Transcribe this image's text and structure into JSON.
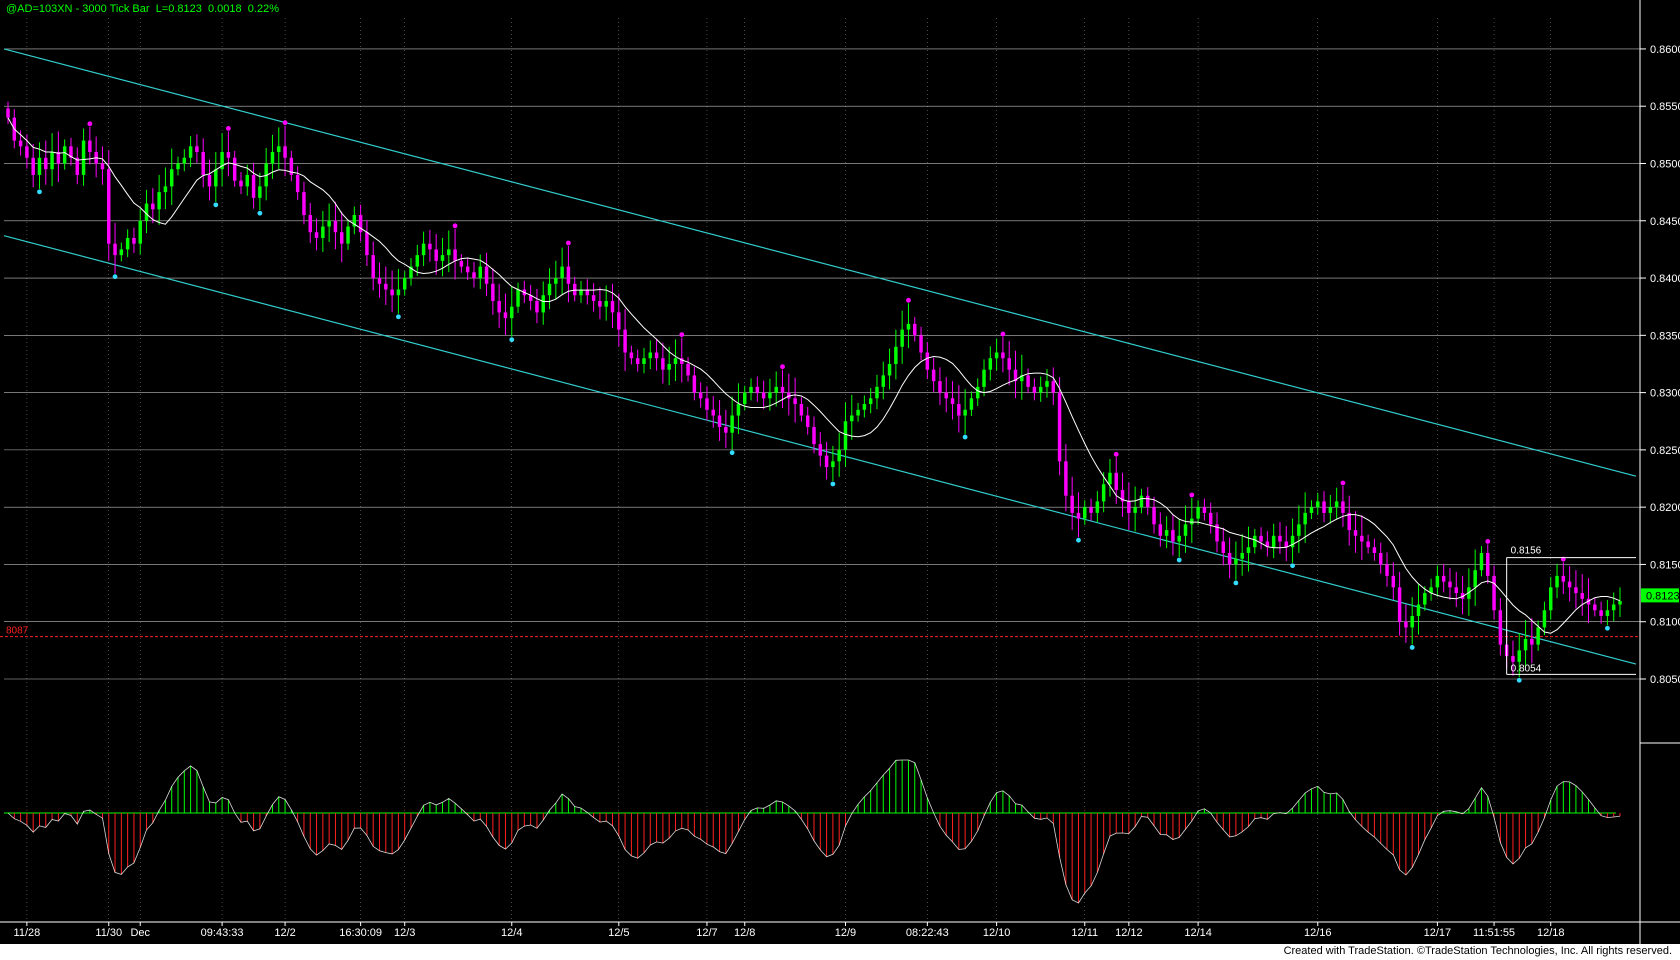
{
  "header": {
    "symbol": "@AD=103XN",
    "separator": " - ",
    "interval": "3000 Tick Bar",
    "last": "L=0.8123",
    "change": "0.0018",
    "pct": "0.22%"
  },
  "footer": {
    "credit": "Created with TradeStation. ©TradeStation Technologies, Inc. All rights reserved."
  },
  "colors": {
    "background": "#000000",
    "up_candle": "#00ff00",
    "down_candle": "#ff00ff",
    "channel": "#33cccc",
    "moving_average": "#ffffff",
    "swing_high_dot": "#ff00ff",
    "swing_low_dot": "#33ddff",
    "osc_positive": "#00ff00",
    "osc_negative": "#ff2020",
    "ref_line": "#ff2020",
    "grid": "#ffffff"
  },
  "chart_data": {
    "type": "line",
    "y_axis": {
      "ticks": [
        0.86,
        0.855,
        0.85,
        0.845,
        0.84,
        0.835,
        0.83,
        0.825,
        0.82,
        0.815,
        0.81,
        0.805
      ],
      "tick_labels": [
        "0.8600",
        "0.8550",
        "0.8500",
        "0.8450",
        "0.8400",
        "0.8350",
        "0.8300",
        "0.8250",
        "0.8200",
        "0.8150",
        "0.8100",
        "0.8050"
      ],
      "range": [
        0.7995,
        0.8627
      ]
    },
    "x_labels": [
      {
        "label": "11/28",
        "bar": 3
      },
      {
        "label": "11/30",
        "bar": 16
      },
      {
        "label": "Dec",
        "bar": 21
      },
      {
        "label": "09:43:33",
        "bar": 34
      },
      {
        "label": "12/2",
        "bar": 44
      },
      {
        "label": "16:30:09",
        "bar": 56
      },
      {
        "label": "12/3",
        "bar": 63
      },
      {
        "label": "12/4",
        "bar": 80
      },
      {
        "label": "12/5",
        "bar": 97
      },
      {
        "label": "12/7",
        "bar": 111
      },
      {
        "label": "12/8",
        "bar": 117
      },
      {
        "label": "12/9",
        "bar": 133
      },
      {
        "label": "08:22:43",
        "bar": 146
      },
      {
        "label": "12/10",
        "bar": 157
      },
      {
        "label": "12/11",
        "bar": 171
      },
      {
        "label": "12/12",
        "bar": 178
      },
      {
        "label": "12/14",
        "bar": 189
      },
      {
        "label": "12/16",
        "bar": 208
      },
      {
        "label": "12/17",
        "bar": 227
      },
      {
        "label": "11:51:55",
        "bar": 236
      },
      {
        "label": "12/18",
        "bar": 245
      }
    ],
    "bar_count": 257,
    "closes": [
      0.854,
      0.852,
      0.8515,
      0.8505,
      0.849,
      0.8505,
      0.8495,
      0.851,
      0.85,
      0.8515,
      0.8505,
      0.849,
      0.852,
      0.851,
      0.85,
      0.8495,
      0.843,
      0.842,
      0.8425,
      0.8435,
      0.843,
      0.845,
      0.8465,
      0.846,
      0.8475,
      0.848,
      0.8495,
      0.85,
      0.8505,
      0.8515,
      0.851,
      0.849,
      0.848,
      0.8495,
      0.851,
      0.8505,
      0.8485,
      0.848,
      0.849,
      0.847,
      0.848,
      0.85,
      0.851,
      0.8515,
      0.8505,
      0.849,
      0.8475,
      0.8455,
      0.844,
      0.8435,
      0.8445,
      0.845,
      0.844,
      0.843,
      0.8445,
      0.8455,
      0.844,
      0.842,
      0.84,
      0.8395,
      0.839,
      0.8385,
      0.839,
      0.84,
      0.841,
      0.842,
      0.843,
      0.8425,
      0.8415,
      0.842,
      0.8425,
      0.8415,
      0.841,
      0.8405,
      0.84,
      0.841,
      0.8395,
      0.838,
      0.837,
      0.8365,
      0.8375,
      0.839,
      0.8385,
      0.838,
      0.837,
      0.8385,
      0.8395,
      0.84,
      0.841,
      0.8395,
      0.8385,
      0.839,
      0.8385,
      0.838,
      0.8375,
      0.838,
      0.837,
      0.8355,
      0.8335,
      0.833,
      0.8325,
      0.833,
      0.8335,
      0.833,
      0.832,
      0.8325,
      0.833,
      0.8325,
      0.8315,
      0.83,
      0.8295,
      0.8285,
      0.828,
      0.827,
      0.8265,
      0.828,
      0.829,
      0.83,
      0.8305,
      0.83,
      0.8295,
      0.83,
      0.8305,
      0.83,
      0.8295,
      0.829,
      0.828,
      0.827,
      0.8255,
      0.8245,
      0.8235,
      0.824,
      0.825,
      0.8275,
      0.828,
      0.8285,
      0.829,
      0.8295,
      0.8305,
      0.8315,
      0.8325,
      0.834,
      0.8355,
      0.836,
      0.835,
      0.8335,
      0.832,
      0.831,
      0.83,
      0.8295,
      0.829,
      0.828,
      0.8285,
      0.8295,
      0.8305,
      0.832,
      0.833,
      0.8335,
      0.833,
      0.832,
      0.831,
      0.8315,
      0.8305,
      0.83,
      0.8305,
      0.831,
      0.83,
      0.824,
      0.821,
      0.8195,
      0.819,
      0.82,
      0.8195,
      0.8205,
      0.822,
      0.823,
      0.8215,
      0.8205,
      0.8195,
      0.82,
      0.821,
      0.82,
      0.8185,
      0.8175,
      0.818,
      0.817,
      0.8175,
      0.8185,
      0.819,
      0.82,
      0.8195,
      0.8185,
      0.817,
      0.816,
      0.815,
      0.8155,
      0.816,
      0.8165,
      0.8175,
      0.817,
      0.8165,
      0.8175,
      0.817,
      0.8165,
      0.8175,
      0.8185,
      0.8195,
      0.82,
      0.8205,
      0.8195,
      0.82,
      0.8205,
      0.8195,
      0.818,
      0.8175,
      0.817,
      0.8165,
      0.816,
      0.815,
      0.814,
      0.813,
      0.81,
      0.8095,
      0.8105,
      0.8115,
      0.8125,
      0.813,
      0.814,
      0.8135,
      0.813,
      0.8125,
      0.812,
      0.813,
      0.8145,
      0.816,
      0.814,
      0.811,
      0.808,
      0.807,
      0.8065,
      0.8075,
      0.8085,
      0.808,
      0.8095,
      0.811,
      0.813,
      0.814,
      0.8135,
      0.813,
      0.8125,
      0.812,
      0.8115,
      0.811,
      0.8105,
      0.811,
      0.8115,
      0.8118,
      0.8123
    ],
    "annotations": {
      "ref_line": {
        "value": 0.8087,
        "label": "8087"
      },
      "last_price": {
        "value": 0.8123,
        "label": "0.8123"
      },
      "range_box": {
        "high": 0.8156,
        "low": 0.8054,
        "high_label": "0.8156",
        "low_label": "0.8054",
        "bar_start": 238,
        "bar_end": 257
      }
    },
    "channel": {
      "upper": {
        "start": {
          "bar": 0,
          "price": 0.86
        },
        "end": {
          "bar": 257,
          "price": 0.8227
        }
      },
      "lower": {
        "start": {
          "bar": 0,
          "price": 0.8437
        },
        "end": {
          "bar": 257,
          "price": 0.8063
        }
      }
    },
    "grid": true
  }
}
